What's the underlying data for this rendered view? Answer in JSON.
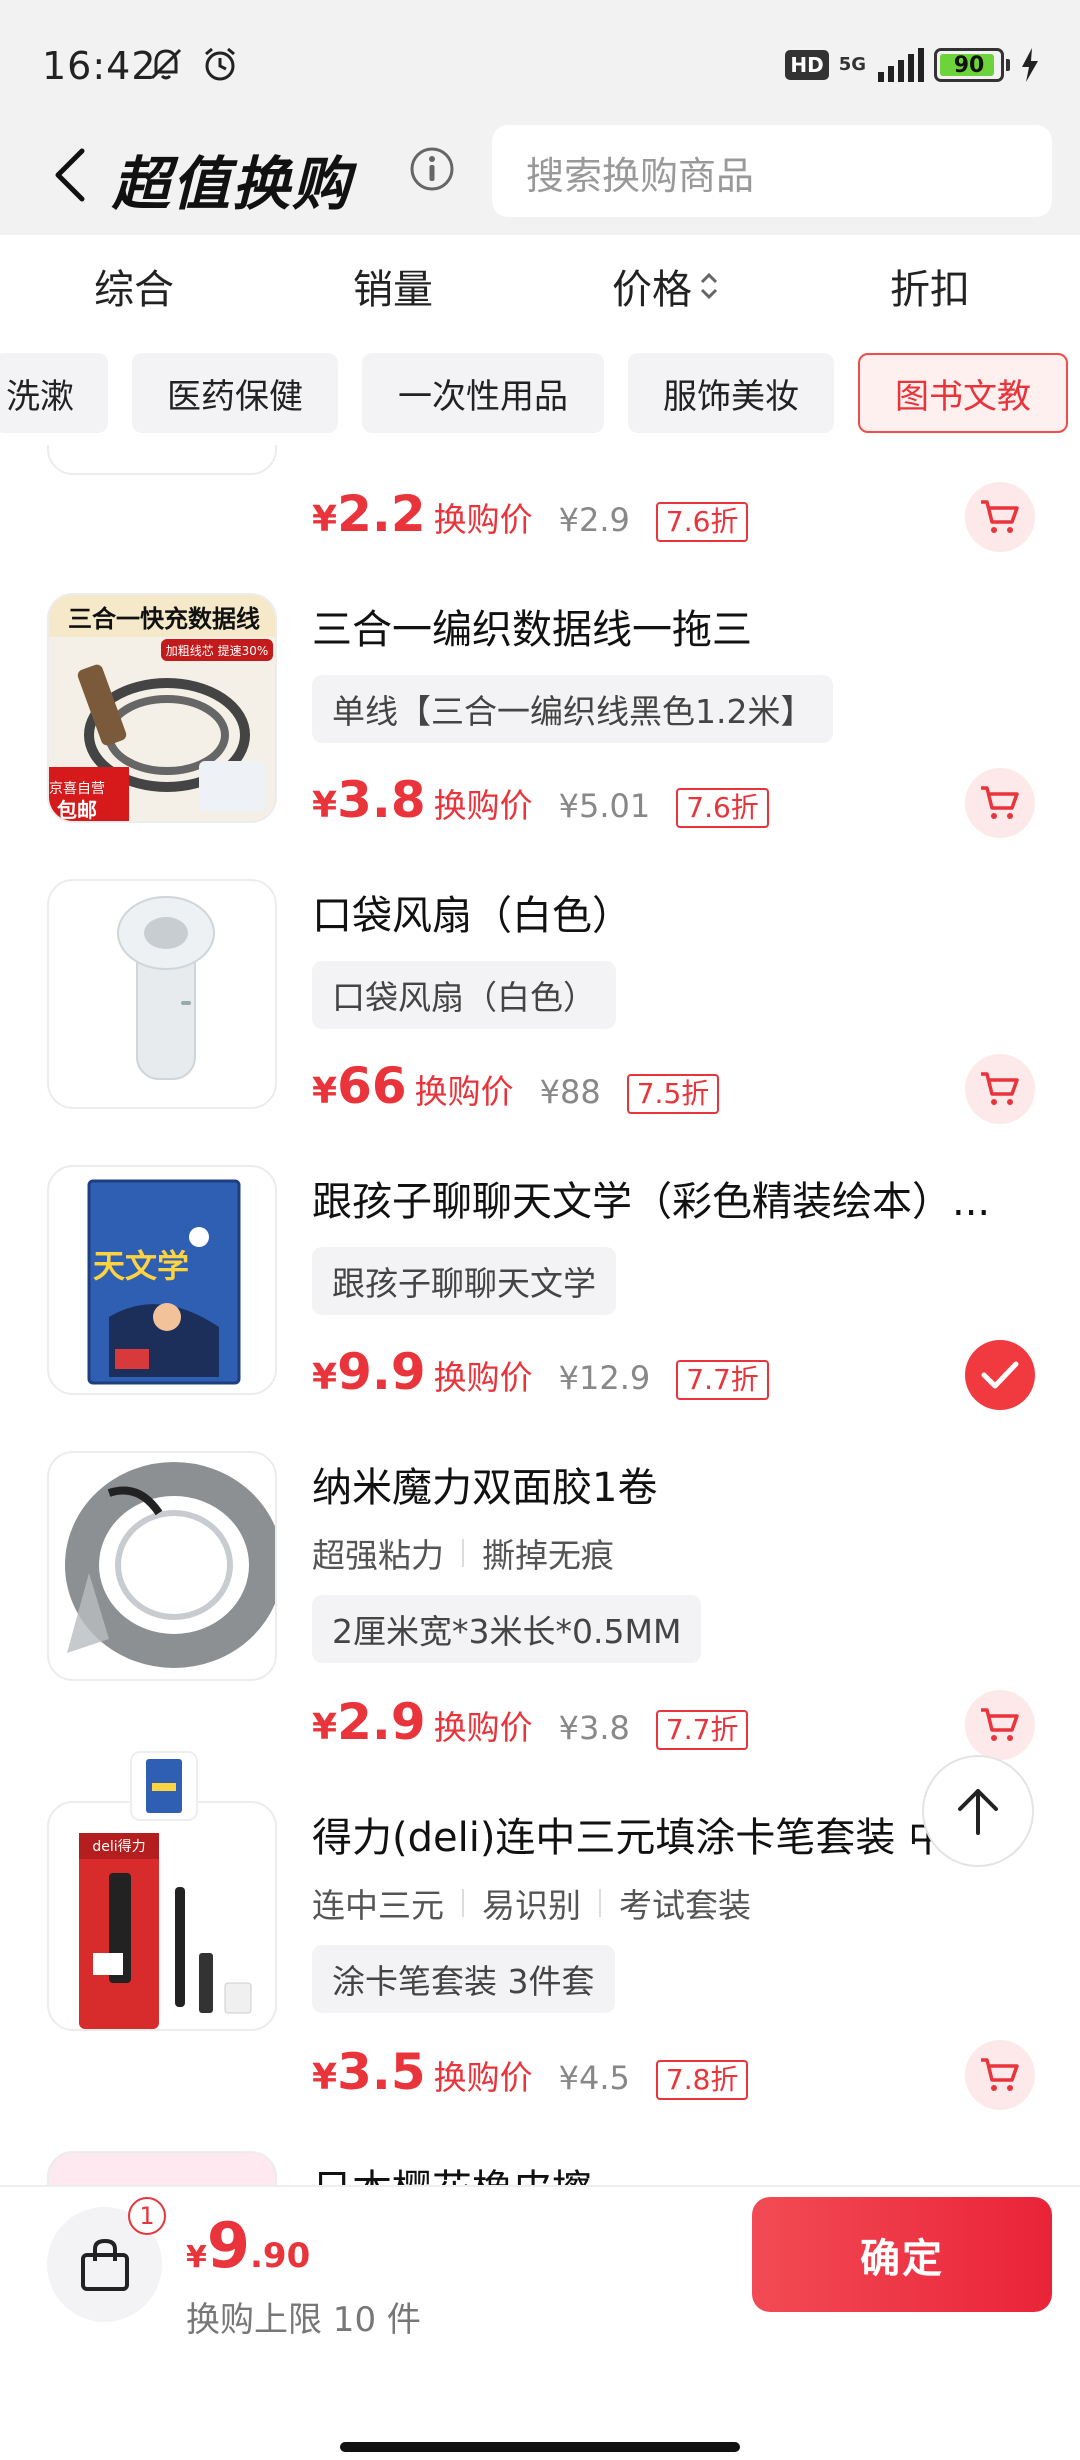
{
  "status_bar": {
    "time": "16:42",
    "network": "5G",
    "hd": "HD",
    "battery": "90"
  },
  "header": {
    "title": "超值换购",
    "search_placeholder": "搜索换购商品"
  },
  "sort_tabs": [
    "综合",
    "销量",
    "价格",
    "折扣"
  ],
  "categories": [
    "洗漱",
    "医药保健",
    "一次性用品",
    "服饰美妆",
    "图书文教"
  ],
  "active_category": "图书文教",
  "price_label": "换购价",
  "currency": "¥",
  "items": [
    {
      "title": "",
      "price": "2.2",
      "orig_price": "¥2.9",
      "discount": "7.6折",
      "selected": false
    },
    {
      "title": "三合一编织数据线一拖三",
      "spec": "单线【三合一编织线黑色1.2米】",
      "price": "3.8",
      "orig_price": "¥5.01",
      "discount": "7.6折",
      "selected": false,
      "thumb_text": {
        "headline": "三合一快充数据线",
        "sub": "加粗线芯 提速30%",
        "corner": "京喜自营",
        "corner2": "包邮"
      }
    },
    {
      "title": "口袋风扇（白色）",
      "spec": "口袋风扇（白色）",
      "price": "66",
      "orig_price": "¥88",
      "discount": "7.5折",
      "selected": false
    },
    {
      "title": "跟孩子聊聊天文学（彩色精装绘本）...",
      "spec": "跟孩子聊聊天文学",
      "price": "9.9",
      "orig_price": "¥12.9",
      "discount": "7.7折",
      "selected": true,
      "thumb_text": {
        "headline": "天文学"
      }
    },
    {
      "title": "纳米魔力双面胶1卷",
      "tags": [
        "超强粘力",
        "撕掉无痕"
      ],
      "spec": "2厘米宽*3米长*0.5MM",
      "price": "2.9",
      "orig_price": "¥3.8",
      "discount": "7.7折",
      "selected": false
    },
    {
      "title": "得力(deli)连中三元填涂卡笔套装 中高...",
      "tags": [
        "连中三元",
        "易识别",
        "考试套装"
      ],
      "spec": "涂卡笔套装 3件套",
      "price": "3.5",
      "orig_price": "¥4.5",
      "discount": "7.8折",
      "selected": false,
      "thumb_text": {
        "brand": "deli得力"
      }
    },
    {
      "title": "日本樱花橡皮擦"
    }
  ],
  "bottom_bar": {
    "badge_count": "1",
    "total_int": "9",
    "total_dec": ".90",
    "limit_text": "换购上限 10 件",
    "confirm_label": "确定"
  },
  "colors": {
    "accent": "#e8343a",
    "chip_active_bg": "#fff0f0",
    "header_bg": "#f2f2f3"
  }
}
